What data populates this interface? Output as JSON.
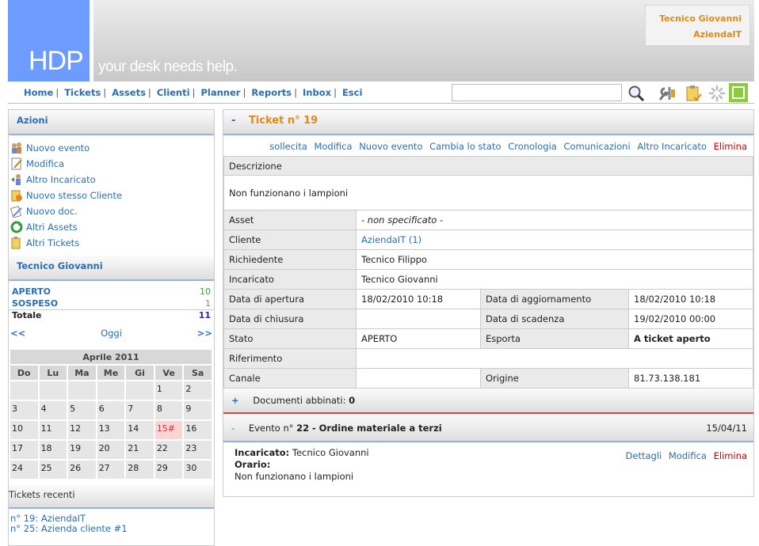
{
  "brand": {
    "logo": "HDP",
    "tagline": "your desk needs help."
  },
  "user": {
    "name": "Tecnico Giovanni",
    "company": "AziendaIT"
  },
  "nav": {
    "items": [
      "Home",
      "Tickets",
      "Assets",
      "Clienti",
      "Planner",
      "Reports",
      "Inbox",
      "Esci"
    ],
    "search_placeholder": ""
  },
  "icons": [
    "search-icon",
    "tools-icon",
    "clipboard-icon",
    "loading-icon",
    "toggle-icon"
  ],
  "colors": {
    "accent": "#2a6fb3",
    "orange": "#e08a18",
    "danger": "#cc0000",
    "logo": "#6e9bff",
    "toggle": "#8ccc3a"
  },
  "sidebar": {
    "actions_title": "Azioni",
    "actions": [
      "Nuovo evento",
      "Modifica",
      "Altro Incaricato",
      "Nuovo stesso Cliente",
      "Nuovo doc.",
      "Altri Assets",
      "Altri Tickets"
    ],
    "user_title": "Tecnico Giovanni",
    "status": [
      {
        "label": "APERTO",
        "value": "10"
      },
      {
        "label": "SOSPESO",
        "value": "1"
      },
      {
        "label": "Totale",
        "value": "11"
      }
    ],
    "cal_prev": "<<",
    "cal_today": "Oggi",
    "cal_next": ">>",
    "calendar": {
      "title": "Aprile 2011",
      "days": [
        "Do",
        "Lu",
        "Ma",
        "Me",
        "Gi",
        "Ve",
        "Sa"
      ],
      "weeks": [
        [
          "",
          "",
          "",
          "",
          "",
          "1",
          "2"
        ],
        [
          "3",
          "4",
          "5",
          "6",
          "7",
          "8",
          "9"
        ],
        [
          "10",
          "11",
          "12",
          "13",
          "14",
          "15#",
          "16"
        ],
        [
          "17",
          "18",
          "19",
          "20",
          "21",
          "22",
          "23"
        ],
        [
          "24",
          "25",
          "26",
          "27",
          "28",
          "29",
          "30"
        ]
      ]
    },
    "recent_title": "Tickets recenti",
    "recent": [
      "n° 19: AziendaIT",
      "n° 25: Azienda cliente #1"
    ]
  },
  "ticket": {
    "title": "Ticket n° 19",
    "actions": [
      "sollecita",
      "Modifica",
      "Nuovo evento",
      "Cambia lo stato",
      "Cronologia",
      "Comunicazioni",
      "Altro Incaricato"
    ],
    "delete": "Elimina",
    "description_label": "Descrizione",
    "description": "Non funzionano i lampioni",
    "asset_label": "Asset",
    "asset": "- non specificato -",
    "cliente_label": "Cliente",
    "cliente": "AziendaIT (1)",
    "richiedente_label": "Richiedente",
    "richiedente": "Tecnico Filippo",
    "incaricato_label": "Incaricato",
    "incaricato": "Tecnico Giovanni",
    "apertura_label": "Data di apertura",
    "apertura": "18/02/2010 10:18",
    "aggiornamento_label": "Data di aggiornamento",
    "aggiornamento": "18/02/2010 10:18",
    "chiusura_label": "Data di chiusura",
    "chiusura": "",
    "scadenza_label": "Data di scadenza",
    "scadenza": "19/02/2010 00:00",
    "stato_label": "Stato",
    "stato": "APERTO",
    "esporta_label": "Esporta",
    "esporta": "A ticket aperto",
    "riferimento_label": "Riferimento",
    "riferimento": "",
    "canale_label": "Canale",
    "canale": "",
    "origine_label": "Origine",
    "origine": "81.73.138.181",
    "docs_label": "Documenti abbinati:",
    "docs_count": "0"
  },
  "event": {
    "prefix": "Evento n°",
    "number": "22",
    "title": "- Ordine materiale a terzi",
    "date": "15/04/11",
    "incaricato_label": "Incaricato:",
    "incaricato": "Tecnico Giovanni",
    "orario_label": "Orario:",
    "text": "Non funzionano i lampioni",
    "links": [
      "Dettagli",
      "Modifica"
    ],
    "delete": "Elimina"
  }
}
